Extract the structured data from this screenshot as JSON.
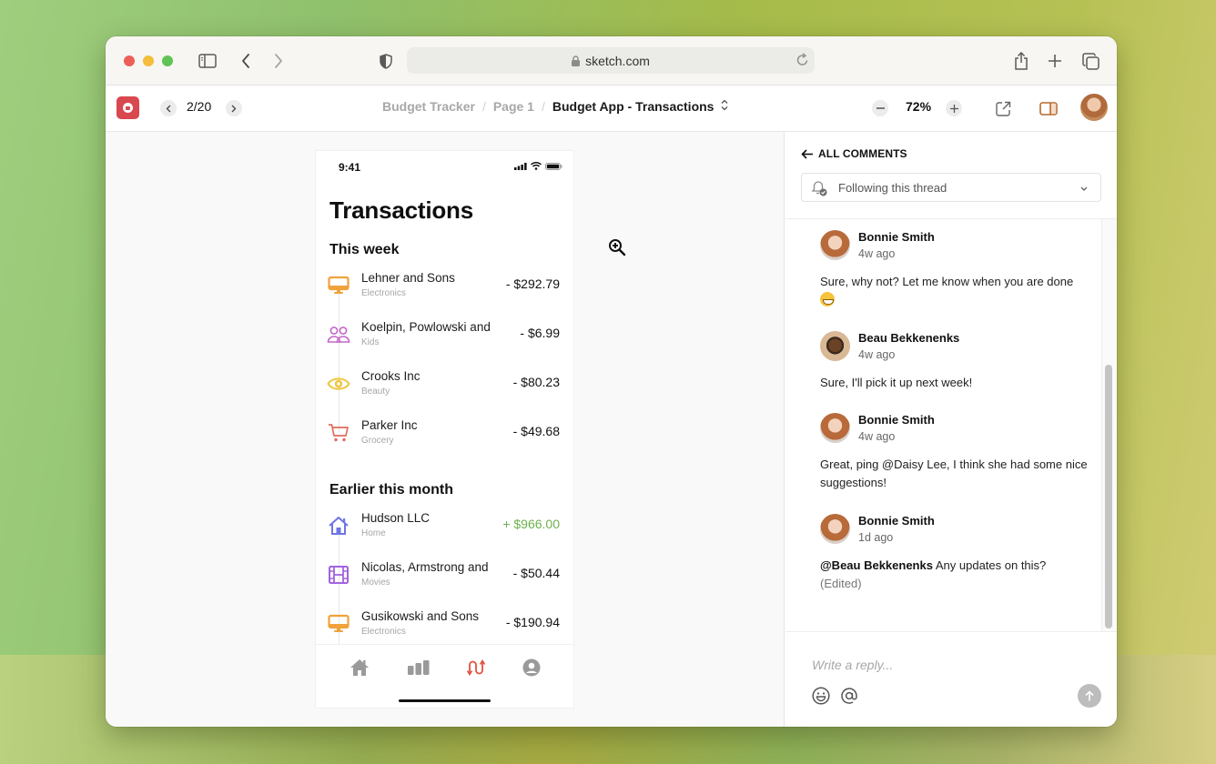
{
  "browser": {
    "url": "sketch.com",
    "icons": [
      "sidebar-icon",
      "back-icon",
      "forward-icon",
      "privacy-shield-icon",
      "lock-icon",
      "reload-icon",
      "share-icon",
      "new-tab-icon",
      "tabs-overview-icon"
    ]
  },
  "toolbar": {
    "page_count": "2/20",
    "breadcrumb": [
      "Budget Tracker",
      "Page 1",
      "Budget App - Transactions"
    ],
    "breadcrumb_separator": "/",
    "zoom_level": "72%"
  },
  "phone": {
    "status_time": "9:41",
    "title": "Transactions",
    "sections": [
      {
        "label": "This week",
        "transactions": [
          {
            "name": "Lehner and Sons",
            "category": "Electronics",
            "amount": "- $292.79",
            "icon": "monitor-icon",
            "color": "#f0a23c",
            "positive": false
          },
          {
            "name": "Koelpin, Powlowski and",
            "category": "Kids",
            "amount": "- $6.99",
            "icon": "people-icon",
            "color": "#c466c9",
            "positive": false
          },
          {
            "name": "Crooks Inc",
            "category": "Beauty",
            "amount": "- $80.23",
            "icon": "eye-icon",
            "color": "#efc53e",
            "positive": false
          },
          {
            "name": "Parker Inc",
            "category": "Grocery",
            "amount": "- $49.68",
            "icon": "cart-icon",
            "color": "#e16b5c",
            "positive": false
          }
        ]
      },
      {
        "label": "Earlier this month",
        "transactions": [
          {
            "name": "Hudson LLC",
            "category": "Home",
            "amount": "+ $966.00",
            "icon": "home-icon",
            "color": "#6f74e6",
            "positive": true
          },
          {
            "name": "Nicolas, Armstrong and",
            "category": "Movies",
            "amount": "- $50.44",
            "icon": "film-icon",
            "color": "#a263e0",
            "positive": false
          },
          {
            "name": "Gusikowski and Sons",
            "category": "Electronics",
            "amount": "- $190.94",
            "icon": "monitor-icon",
            "color": "#f0a23c",
            "positive": false
          }
        ]
      }
    ],
    "tabbar": [
      {
        "icon": "home-icon",
        "active": false
      },
      {
        "icon": "stats-icon",
        "active": false
      },
      {
        "icon": "transactions-icon",
        "active": true
      },
      {
        "icon": "profile-icon",
        "active": false
      }
    ],
    "colors": {
      "active_tab": "#e0533f",
      "inactive_tab": "#9a9a9a",
      "positive_amount": "#6bb14b"
    }
  },
  "comments_panel": {
    "back_label": "ALL COMMENTS",
    "follow_status": "Following this thread",
    "comments": [
      {
        "author": "Bonnie Smith",
        "time": "4w ago",
        "avatar": "bonnie",
        "text": "Sure, why not? Let me know when you are done",
        "emoji": "grinning-face"
      },
      {
        "author": "Beau Bekkenenks",
        "time": "4w ago",
        "avatar": "beau",
        "text": "Sure, I'll pick it up next week!"
      },
      {
        "author": "Bonnie Smith",
        "time": "4w ago",
        "avatar": "bonnie",
        "text": "Great, ping @Daisy Lee, I think she had some nice suggestions!"
      },
      {
        "author": "Bonnie Smith",
        "time": "1d ago",
        "avatar": "bonnie",
        "mention": "@Beau Bekkenenks",
        "text": " Any updates on this?",
        "edited": "(Edited)"
      }
    ],
    "reply_placeholder": "Write a reply..."
  }
}
